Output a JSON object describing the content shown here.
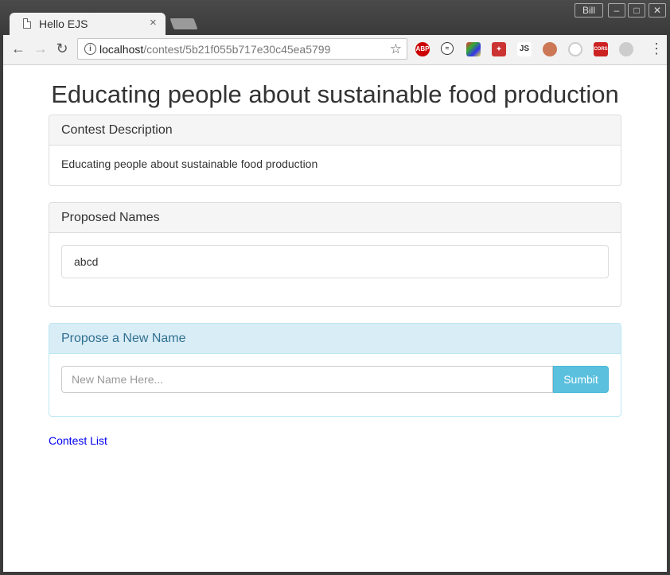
{
  "browser": {
    "tab_title": "Hello EJS",
    "tab_close": "×",
    "user_label": "Bill",
    "url_host": "localhost",
    "url_path": "/contest/5b21f055b717e30c45ea5799",
    "extensions": [
      "adblock-icon",
      "sync-icon",
      "colorpicker-icon",
      "ext-red-icon",
      "js-icon",
      "monkey-icon",
      "target-icon",
      "cors-icon",
      "ext-gray-icon"
    ],
    "ext_labels": {
      "abp": "ABP",
      "js": "JS",
      "cors": "CORS"
    }
  },
  "page": {
    "title": "Educating people about sustainable food production",
    "description_panel": {
      "heading": "Contest Description",
      "body": "Educating people about sustainable food production"
    },
    "names_panel": {
      "heading": "Proposed Names",
      "names": [
        "abcd"
      ]
    },
    "propose_panel": {
      "heading": "Propose a New Name",
      "placeholder": "New Name Here...",
      "submit_label": "Sumbit"
    },
    "contest_list_link": "Contest List"
  },
  "colors": {
    "info_heading_bg": "#d9edf7",
    "info_text": "#31708f",
    "submit_bg": "#5bc0de",
    "link": "#0000ee"
  }
}
